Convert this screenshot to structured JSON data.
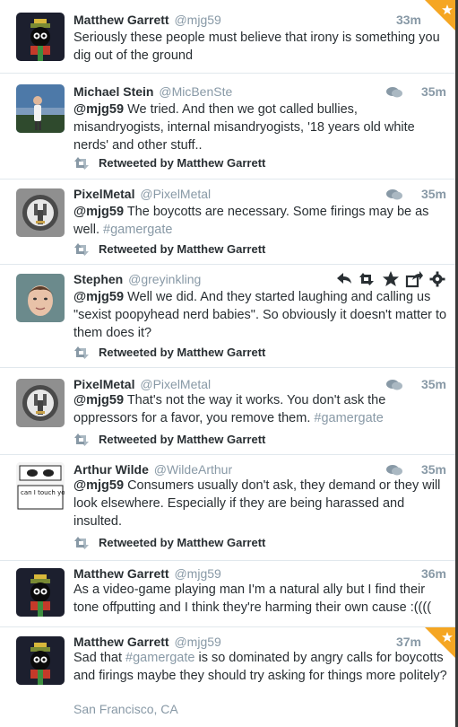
{
  "tweets": [
    {
      "name": "Matthew Garrett",
      "handle": "@mjg59",
      "time": "33m",
      "text": "Seriously these people must believe that irony is something you dig out of the ground",
      "avatar": "marvin-avatar",
      "favorited": true
    },
    {
      "name": "Michael Stein",
      "handle": "@MicBenSte",
      "time": "35m",
      "mention": "@mjg59",
      "text": " We tried. And then we got called bullies, misandryogists, internal misandryogists, '18 years old white nerds' and other stuff..",
      "retweeted_by": "Retweeted by Matthew Garrett",
      "avatar": "person-photo-avatar"
    },
    {
      "name": "PixelMetal",
      "handle": "@PixelMetal",
      "time": "35m",
      "mention": "@mjg59",
      "text": " The boycotts are necessary. Some firings may be as well. ",
      "hashtag": "#gamergate",
      "retweeted_by": "Retweeted by Matthew Garrett",
      "avatar": "speaker-avatar"
    },
    {
      "name": "Stephen",
      "handle": "@greyinkling",
      "mention": "@mjg59",
      "text": " Well we did. And they started laughing and calling us \"sexist poopyhead nerd babies\". So obviously it doesn't matter to them does it?",
      "retweeted_by": "Retweeted by Matthew Garrett",
      "avatar": "face-photo-avatar"
    },
    {
      "name": "PixelMetal",
      "handle": "@PixelMetal",
      "time": "35m",
      "mention": "@mjg59",
      "text": " That's not the way it works. You don't ask the oppressors for a favor, you remove them. ",
      "hashtag": "#gamergate",
      "retweeted_by": "Retweeted by Matthew Garrett",
      "avatar": "speaker-avatar"
    },
    {
      "name": "Arthur Wilde",
      "handle": "@WildeArthur",
      "time": "35m",
      "mention": "@mjg59",
      "text": " Consumers usually don't ask, they demand or they will look elsewhere. Especially if they are being harassed and insulted.",
      "retweeted_by": "Retweeted by Matthew Garrett",
      "avatar": "comic-avatar",
      "avatar_text": "can I touch your nose plz"
    },
    {
      "name": "Matthew Garrett",
      "handle": "@mjg59",
      "time": "36m",
      "text": "As a video-game playing man I'm a natural ally but I find their tone offputting and I think they're harming their own cause :((((",
      "avatar": "marvin-avatar"
    },
    {
      "name": "Matthew Garrett",
      "handle": "@mjg59",
      "time": "37m",
      "text_before": "Sad that ",
      "hashtag": "#gamergate",
      "text": " is so dominated by angry calls for boycotts and firings maybe they should try asking for things more politely?",
      "location": "San Francisco, CA",
      "avatar": "marvin-avatar",
      "favorited": true
    }
  ],
  "colors": {
    "star_corner": "#f5a623",
    "muted": "#8899a6",
    "text": "#292f33",
    "divider": "#e1e8ed"
  },
  "icons": [
    "retweet-icon",
    "conversation-icon",
    "reply-icon",
    "favorite-icon",
    "share-icon",
    "gear-icon",
    "favorite-corner-icon"
  ]
}
